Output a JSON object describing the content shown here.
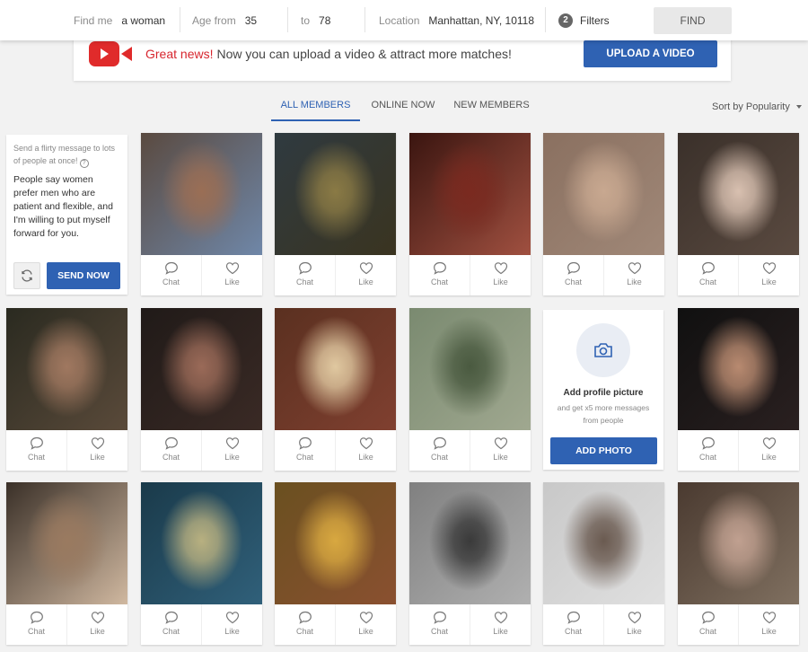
{
  "search": {
    "find_me_label": "Find me",
    "find_me_value": "a woman",
    "age_from_label": "Age from",
    "age_from_value": "35",
    "age_to_label": "to",
    "age_to_value": "78",
    "location_label": "Location",
    "location_value": "Manhattan, NY, 10118",
    "filters_count": "2",
    "filters_label": "Filters",
    "find_label": "FIND"
  },
  "promo": {
    "highlight": "Great news!",
    "text": "Now you can upload a video & attract more matches!",
    "button_label": "UPLOAD A VIDEO"
  },
  "tabs": [
    {
      "label": "ALL MEMBERS",
      "active": true
    },
    {
      "label": "ONLINE NOW",
      "active": false
    },
    {
      "label": "NEW MEMBERS",
      "active": false
    }
  ],
  "sort": {
    "label": "Sort by Popularity"
  },
  "flirt": {
    "hint": "Send a flirty message to lots of people at once!",
    "message": "People say women prefer men who are patient and flexible, and I'm willing to put myself forward for you.",
    "send_label": "SEND NOW"
  },
  "add_photo": {
    "title": "Add profile picture",
    "subtitle": "and get x5 more messages from people",
    "button_label": "ADD PHOTO"
  },
  "card_actions": {
    "chat": "Chat",
    "like": "Like"
  },
  "colors": {
    "accent": "#2f62b3",
    "brand_red": "#d7262e"
  },
  "members": [
    {
      "row": 0,
      "col": 1,
      "photo_colors": [
        "#5a4a40",
        "#9a6e55",
        "#6f87a8"
      ]
    },
    {
      "row": 0,
      "col": 2,
      "photo_colors": [
        "#2f3a40",
        "#8a7a45",
        "#3a3420"
      ]
    },
    {
      "row": 0,
      "col": 3,
      "photo_colors": [
        "#3a1510",
        "#7a2a20",
        "#a05040"
      ]
    },
    {
      "row": 0,
      "col": 4,
      "photo_colors": [
        "#8a7060",
        "#c8a890",
        "#a08878"
      ]
    },
    {
      "row": 0,
      "col": 5,
      "photo_colors": [
        "#3a302a",
        "#d8c0b0",
        "#5a4a40"
      ]
    },
    {
      "row": 1,
      "col": 0,
      "photo_colors": [
        "#2a2a20",
        "#a07860",
        "#5a4a3a"
      ]
    },
    {
      "row": 1,
      "col": 1,
      "photo_colors": [
        "#201a18",
        "#9a6a58",
        "#3a2a25"
      ]
    },
    {
      "row": 1,
      "col": 2,
      "photo_colors": [
        "#5a3020",
        "#e0c8a0",
        "#804030"
      ]
    },
    {
      "row": 1,
      "col": 3,
      "photo_colors": [
        "#7a8a70",
        "#4a5a40",
        "#a0a890"
      ]
    },
    {
      "row": 1,
      "col": 5,
      "photo_colors": [
        "#101010",
        "#b88a70",
        "#2a2020"
      ]
    },
    {
      "row": 2,
      "col": 0,
      "photo_colors": [
        "#3a3028",
        "#9a7a60",
        "#d0b8a0"
      ]
    },
    {
      "row": 2,
      "col": 1,
      "photo_colors": [
        "#1a3a4a",
        "#b8b080",
        "#30607a"
      ]
    },
    {
      "row": 2,
      "col": 2,
      "photo_colors": [
        "#6a5020",
        "#d8a840",
        "#8a5030"
      ]
    },
    {
      "row": 2,
      "col": 3,
      "photo_colors": [
        "#808080",
        "#3a3a3a",
        "#b0b0b0"
      ]
    },
    {
      "row": 2,
      "col": 4,
      "photo_colors": [
        "#c8c8c8",
        "#6a5a50",
        "#e0e0e0"
      ]
    },
    {
      "row": 2,
      "col": 5,
      "photo_colors": [
        "#4a3a30",
        "#c0a090",
        "#807060"
      ]
    }
  ]
}
